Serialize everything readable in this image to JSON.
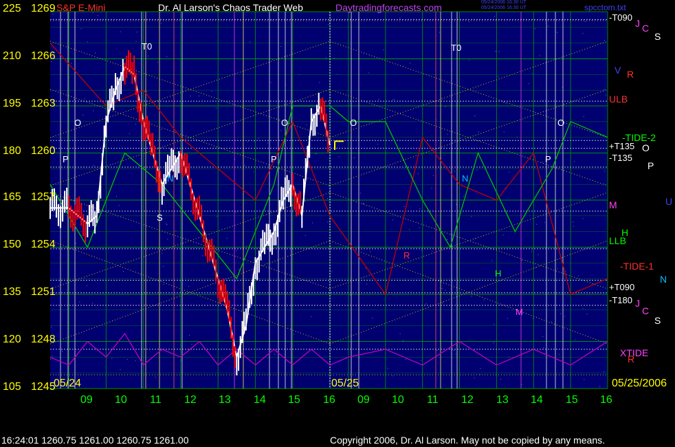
{
  "header": {
    "instrument": "S&P E-Mini",
    "author_title": "Dr. Al Larson's Chaos Trader Web",
    "site": "Daytradingforecasts.com",
    "timestamp_line1": "05/24/2006 16:30 UT",
    "timestamp_line2": "05/24/2006 16:30 UT",
    "filename": "spcctom.txt"
  },
  "footer": {
    "quote": "16:24:01  1260.75  1261.00  1260.75  1261.00",
    "copyright": "Copyright 2006, Dr. Al Larson. May not be copied by any means."
  },
  "left_axis": {
    "scale_a": [
      "225",
      "210",
      "195",
      "180",
      "165",
      "150",
      "135",
      "120",
      "105"
    ],
    "scale_b": [
      "1269",
      "1266",
      "1263",
      "1260",
      "1257",
      "1254",
      "1251",
      "1248",
      "1245"
    ]
  },
  "date_labels": {
    "day1": "05/24",
    "day2": "05/25",
    "right": "05/25/2006"
  },
  "hour_ticks": [
    "09",
    "10",
    "11",
    "12",
    "13",
    "14",
    "15",
    "16",
    "09",
    "10",
    "11",
    "12",
    "13",
    "14",
    "15",
    "16"
  ],
  "right_labels": {
    "t090_top": "-T090",
    "ulb": "ULB",
    "tide2": "-TIDE-2",
    "t135p": "+T135",
    "t135m": "-T135",
    "m": "M",
    "llb": "LLB",
    "tide1": "-TIDE-1",
    "t090p": "+T090",
    "t180": "-T180",
    "xtide": "XTIDE"
  },
  "planet_labels": {
    "j1": "J",
    "c1": "C",
    "s1": "S",
    "v": "V",
    "r1": "R",
    "o1": "O",
    "p1": "P",
    "u": "U",
    "h": "H",
    "n": "N",
    "j2": "J",
    "c2": "C",
    "s2": "S",
    "r2": "R"
  },
  "chart_markers": {
    "t0a": "T0",
    "t0b": "T0",
    "o": "O",
    "p": "P",
    "n": "N",
    "s": "S",
    "r": "R",
    "h": "H",
    "m": "M"
  },
  "colors": {
    "background": "#000000",
    "plot_bg": "#000070",
    "grid": "#00a000",
    "price_up": "#ffffff",
    "price_down": "#ff0000",
    "forecast_red": "#c00000",
    "forecast_green": "#00c000",
    "xtide": "#c000c0",
    "dotted_lines": "#e0e000",
    "labels": "#ffff00"
  },
  "chart_data": {
    "type": "line",
    "title": "Dr. Al Larson's Chaos Trader Web",
    "y_range_price": [
      1245,
      1269
    ],
    "y_range_alt": [
      105,
      225
    ],
    "x_days": [
      "05/24",
      "05/25"
    ],
    "x_hours": [
      "09",
      "10",
      "11",
      "12",
      "13",
      "14",
      "15",
      "16"
    ],
    "series": [
      {
        "name": "S&P E-Mini",
        "x": [
          "05/24 08:30",
          "05/24 09:00",
          "05/24 09:30",
          "05/24 09:45",
          "05/24 10:00",
          "05/24 10:15",
          "05/24 10:30",
          "05/24 10:45",
          "05/24 11:00",
          "05/24 11:15",
          "05/24 11:30",
          "05/24 11:45",
          "05/24 12:00",
          "05/24 12:30",
          "05/24 13:00",
          "05/24 13:15",
          "05/24 13:30",
          "05/24 13:45",
          "05/24 14:00",
          "05/24 14:15",
          "05/24 14:30",
          "05/24 14:45",
          "05/24 15:00",
          "05/24 15:15",
          "05/24 15:30",
          "05/24 15:45",
          "05/24 16:00"
        ],
        "values": [
          1256.5,
          1256.5,
          1255.5,
          1256,
          1262,
          1264,
          1265.5,
          1265,
          1262,
          1260,
          1258,
          1259,
          1260,
          1256,
          1252,
          1250,
          1247,
          1249,
          1253,
          1254,
          1255,
          1257,
          1258,
          1256,
          1262,
          1263,
          1260.5
        ]
      },
      {
        "name": "forecast red",
        "x": [
          "05/24 08:30",
          "05/24 10:00",
          "05/24 11:00",
          "05/24 12:00",
          "05/24 13:00",
          "05/24 14:00",
          "05/24 15:00",
          "05/24 16:00",
          "05/25 10:00",
          "05/25 11:00",
          "05/25 12:00",
          "05/25 13:00",
          "05/25 14:00",
          "05/25 15:00",
          "05/25 16:00"
        ],
        "values": [
          1267,
          1263,
          1264,
          1261,
          1259,
          1257,
          1262,
          1256,
          1251,
          1261,
          1258,
          1257,
          1260,
          1251,
          1252
        ]
      },
      {
        "name": "forecast green",
        "x": [
          "05/24 08:30",
          "05/24 09:30",
          "05/24 10:30",
          "05/24 11:30",
          "05/24 12:30",
          "05/24 13:30",
          "05/24 14:30",
          "05/24 15:00",
          "05/24 16:00",
          "05/25 09:00",
          "05/25 10:00",
          "05/25 11:00",
          "05/25 11:45",
          "05/25 12:30",
          "05/25 13:30",
          "05/25 14:30",
          "05/25 15:00",
          "05/25 16:00"
        ],
        "values": [
          1258,
          1254,
          1260,
          1258,
          1255,
          1252,
          1258,
          1263,
          1263,
          1262,
          1262,
          1257,
          1254,
          1260,
          1255,
          1259,
          1262,
          1261
        ]
      },
      {
        "name": "XTIDE",
        "x": [
          "05/24 08:30",
          "05/24 09:00",
          "05/24 09:30",
          "05/24 10:00",
          "05/24 10:30",
          "05/24 11:00",
          "05/24 11:30",
          "05/24 12:00",
          "05/24 12:30",
          "05/24 13:00",
          "05/24 13:30",
          "05/24 14:00",
          "05/24 14:30",
          "05/24 15:00",
          "05/24 15:30",
          "05/24 16:00",
          "05/25 09:00",
          "05/25 10:00",
          "05/25 11:00",
          "05/25 12:00",
          "05/25 13:00",
          "05/25 14:00",
          "05/25 15:00",
          "05/25 16:00"
        ],
        "values": [
          1247,
          1246.5,
          1248,
          1247,
          1248.5,
          1246.5,
          1247.5,
          1247,
          1248,
          1246.5,
          1247.5,
          1246.5,
          1247.5,
          1246.5,
          1247.5,
          1246.5,
          1247,
          1247.5,
          1246.5,
          1248,
          1246.5,
          1247.5,
          1246.5,
          1248
        ]
      }
    ],
    "horizontal_levels": [
      {
        "name": "-T090",
        "value": 1268.5
      },
      {
        "name": "ULB",
        "value": 1263.3
      },
      {
        "name": "-TIDE-2",
        "value": 1260.8
      },
      {
        "name": "+T135",
        "value": 1260.3
      },
      {
        "name": "-T135",
        "value": 1259.1
      },
      {
        "name": "M",
        "value": 1256.3
      },
      {
        "name": "LLB",
        "value": 1253.9
      },
      {
        "name": "-TIDE-1",
        "value": 1251.9
      },
      {
        "name": "+T090",
        "value": 1251.1
      },
      {
        "name": "-T180",
        "value": 1250.3
      },
      {
        "name": "XTIDE",
        "value": 1247.5
      }
    ],
    "grid": true
  }
}
